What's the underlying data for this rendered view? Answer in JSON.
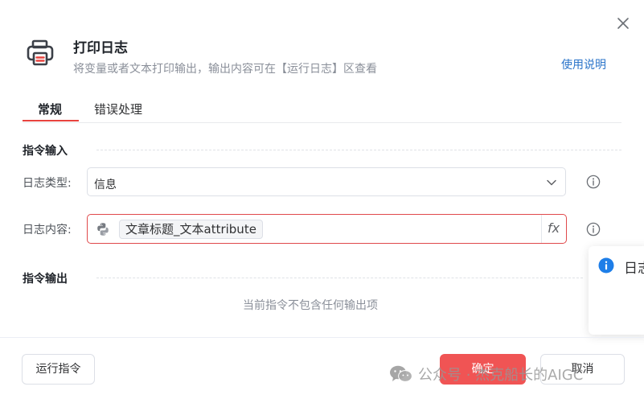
{
  "dialog": {
    "title": "打印日志",
    "subtitle": "将变量或者文本打印输出，输出内容可在【运行日志】区查看",
    "help_link": "使用说明",
    "icon": "printer-icon",
    "close_icon": "close-icon"
  },
  "tabs": [
    {
      "label": "常规",
      "active": true
    },
    {
      "label": "错误处理",
      "active": false
    }
  ],
  "input_section": {
    "title": "指令输入",
    "log_type": {
      "label": "日志类型:",
      "value": "信息"
    },
    "log_content": {
      "label": "日志内容:",
      "chip": "文章标题_文本attribute",
      "fx": "fx"
    }
  },
  "output_section": {
    "title": "指令输出",
    "empty_text": "当前指令不包含任何输出项"
  },
  "notification": {
    "text": "日志"
  },
  "footer": {
    "run_label": "运行指令",
    "ok_label": "确定",
    "cancel_label": "取消"
  },
  "watermark": {
    "text": "公众号 · 杰克船长的AIGC"
  },
  "colors": {
    "accent": "#f05454",
    "link": "#2b74c9",
    "error_border": "#e0494b",
    "info": "#1e7ee8"
  }
}
